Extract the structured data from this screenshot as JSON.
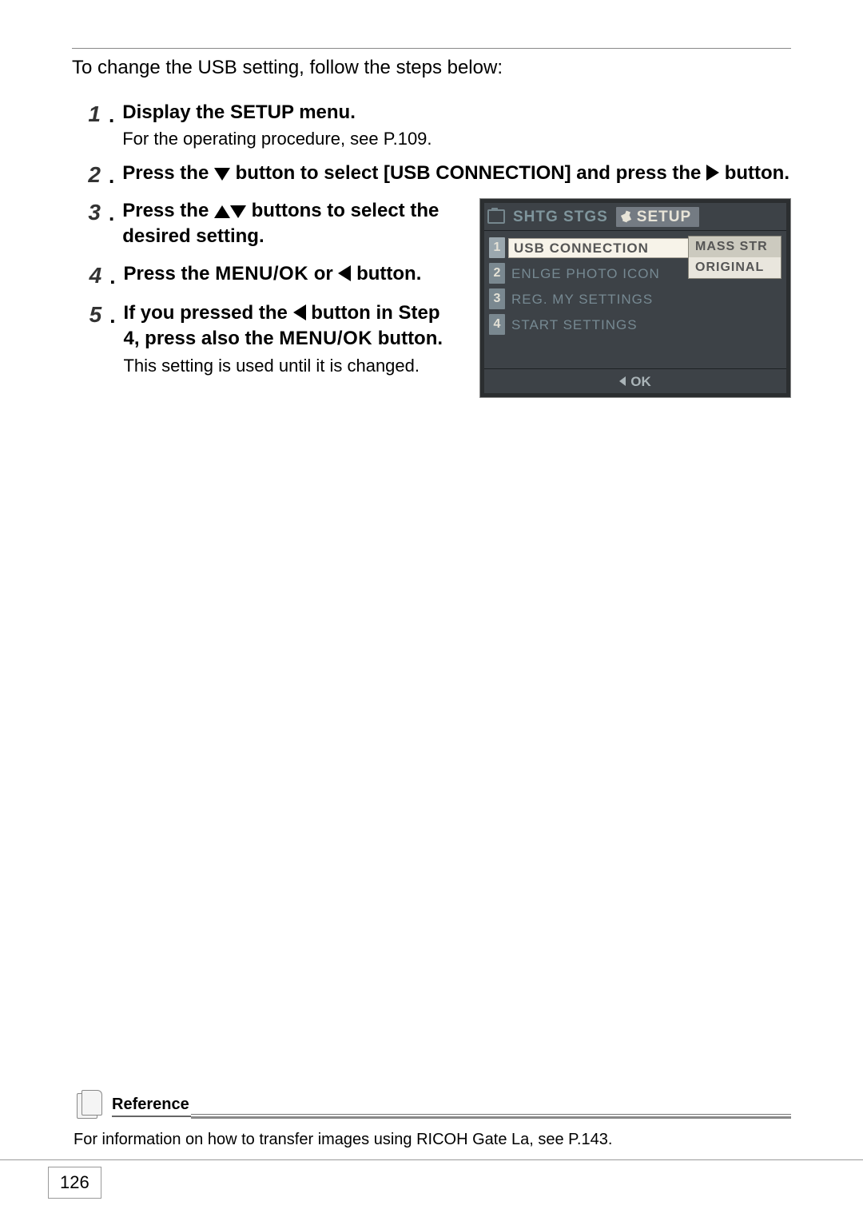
{
  "intro": "To change the USB setting, follow the steps below:",
  "steps": [
    {
      "n": "1",
      "head": "Display the SETUP menu.",
      "sub": "For the operating procedure, see P.109."
    },
    {
      "n": "2",
      "head_pre": "Press the ",
      "head_mid": " button to select [USB CONNECTION] and press the ",
      "head_post": " button."
    },
    {
      "n": "3",
      "head_pre": "Press the ",
      "head_post": " buttons to select the desired setting."
    },
    {
      "n": "4",
      "head_pre": "Press the ",
      "menuok": "MENU/OK",
      "head_mid": " or ",
      "head_post": " button."
    },
    {
      "n": "5",
      "head_pre": "If you pressed the ",
      "head_mid": " button in Step 4, press also the ",
      "menuok": "MENU/OK",
      "head_post": " button.",
      "sub": "This setting is used until it is changed."
    }
  ],
  "camera_screen": {
    "tab_inactive": "SHTG STGS",
    "tab_active": "SETUP",
    "selected_label": "USB CONNECTION",
    "selected_value": "MASS STR",
    "rows": [
      {
        "idx": "2",
        "label": "ENLGE PHOTO ICON"
      },
      {
        "idx": "3",
        "label": "REG. MY SETTINGS"
      },
      {
        "idx": "4",
        "label": "START SETTINGS"
      }
    ],
    "dropdown": [
      "MASS STR",
      "ORIGINAL"
    ],
    "footer": "OK"
  },
  "reference": {
    "label": "Reference",
    "body": "For information on how to transfer images using RICOH Gate La, see P.143."
  },
  "page_number": "126"
}
